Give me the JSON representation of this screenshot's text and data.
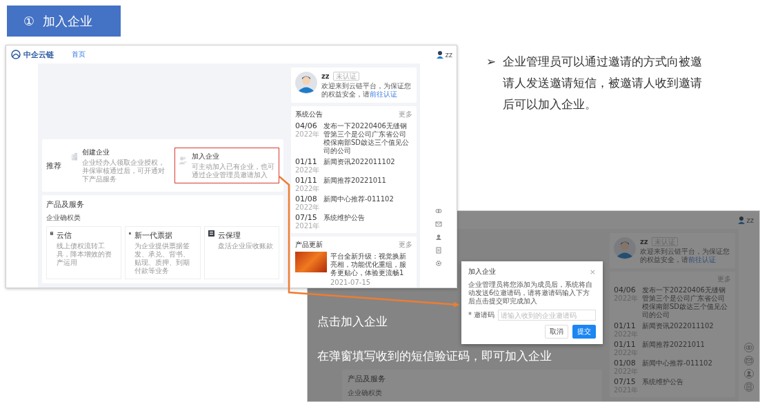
{
  "badge": {
    "number": "①",
    "title": "加入企业"
  },
  "note": {
    "marker": "➢",
    "text": "企业管理员可以通过邀请的方式向被邀请人发送邀请短信，被邀请人收到邀请后可以加入企业。"
  },
  "portal_screenshot": {
    "logo": "中企云链",
    "nav": [
      {
        "label": "首页",
        "selected": true
      }
    ],
    "user": "zz",
    "recommend": {
      "label": "推荐",
      "cards": [
        {
          "kind": "building",
          "title": "创建企业",
          "desc": "企业经办人领取企业授权，并保审核通过后，可开通对下产品服务",
          "highlighted": false
        },
        {
          "kind": "people",
          "title": "加入企业",
          "desc": "可主动加入已有企业，也可通过企业管理员邀请加入",
          "highlighted": true
        }
      ]
    },
    "products": {
      "title": "产品及服务",
      "category": "企业确权类",
      "items": [
        {
          "name": "云信",
          "desc": "线上债权流转工具，降本增效的资产运用"
        },
        {
          "name": "新一代票据",
          "desc": "为企业提供票据签发、承兑、背书、贴现、质押、到期付款等业务"
        },
        {
          "name": "云保理",
          "desc": "盘活企业应收账款"
        }
      ]
    },
    "profile": {
      "name": "zz",
      "badge": "未认证",
      "message": "欢迎来到云链平台，为保证您的权益安全，请",
      "link": "前往认证"
    },
    "notices": {
      "title": "系统公告",
      "more": "更多",
      "items": [
        {
          "date": "04/06",
          "year": "2022年",
          "text": "发布一下20220406无缝钢管第三个是公司广东省公司模保南部SD啟达三个值见公司的公司"
        },
        {
          "date": "01/11",
          "year": "2022年",
          "text": "新闻资讯2022011102"
        },
        {
          "date": "01/11",
          "year": "2022年",
          "text": "新闻推荐20221011"
        },
        {
          "date": "01/08",
          "year": "2022年",
          "text": "新闻中心推荐-011102"
        },
        {
          "date": "07/15",
          "year": "2021年",
          "text": "系统维护公告"
        }
      ]
    },
    "updates": {
      "title": "产品更新",
      "more": "更多",
      "items": [
        {
          "text": "平台全新升级：视觉换新亮相，功能优化重组，服务更贴心，体验更流畅1",
          "date": "2021-07-15"
        }
      ]
    }
  },
  "dialog_screenshot": {
    "user": "zz",
    "profile": {
      "name": "zz",
      "badge": "未认证",
      "message": "欢迎来到云链平台，为保证您的权益安全，请",
      "link": "前往认证"
    },
    "notices": {
      "more": "更多",
      "items": [
        {
          "date": "04/06",
          "year": "2022年",
          "text": "发布一下20220406无缝钢管第三个是公司广东省公司模保南部SD啟达三个值见公司的公司"
        },
        {
          "date": "01/11",
          "year": "2022年",
          "text": "新闻资讯2022011102"
        },
        {
          "date": "01/11",
          "year": "2022年",
          "text": "新闻推荐20221011"
        },
        {
          "date": "01/08",
          "year": "2022年",
          "text": "新闻中心推荐-011102"
        },
        {
          "date": "07/15",
          "year": "2021年",
          "text": "系统维护公告"
        }
      ]
    },
    "products": {
      "title": "产品及服务",
      "category": "企业确权类"
    },
    "dialog": {
      "title": "加入企业",
      "close": "×",
      "message": "企业管理员将您添加为成员后，系统将自动发送6位邀请码，请将邀请码输入下方后点击提交即完成加入",
      "field_label": "* 邀请码",
      "placeholder": "请输入收到的企业邀请码",
      "buttons": [
        {
          "label": "取消",
          "primary": false
        },
        {
          "label": "提交",
          "primary": true
        }
      ]
    }
  },
  "captions": [
    "点击加入企业",
    "在弹窗填写收到的短信验证码，即可加入企业"
  ]
}
